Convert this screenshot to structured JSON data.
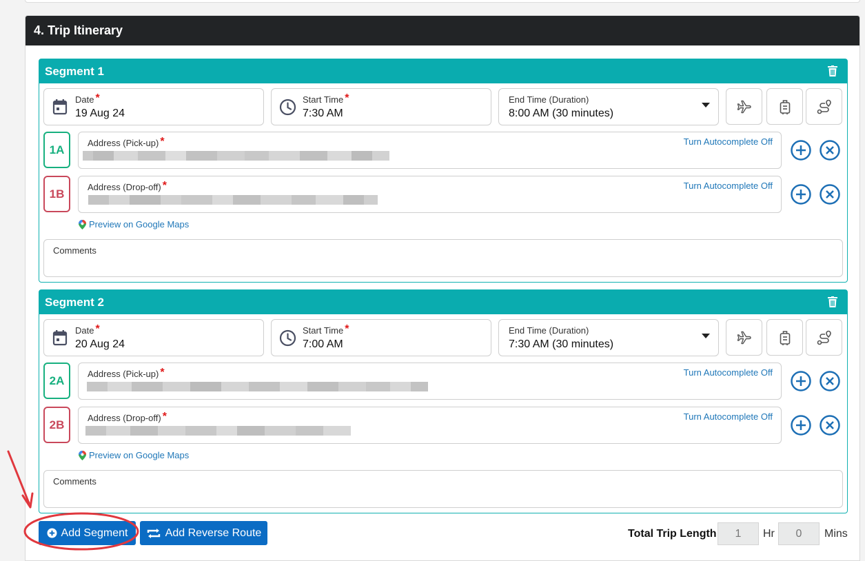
{
  "section": {
    "title": "4. Trip Itinerary"
  },
  "labels": {
    "date": "Date",
    "start_time": "Start Time",
    "end_time": "End Time (Duration)",
    "pickup": "Address (Pick-up)",
    "dropoff": "Address (Drop-off)",
    "required_mark": "*",
    "autocomplete": "Turn Autocomplete Off",
    "preview_maps": "Preview on Google Maps",
    "comments": "Comments"
  },
  "segments": [
    {
      "title": "Segment 1",
      "date": "19 Aug 24",
      "start_time": "7:30 AM",
      "end_time": "8:00 AM (30 minutes)",
      "pickup_badge": "1A",
      "dropoff_badge": "1B"
    },
    {
      "title": "Segment 2",
      "date": "20 Aug 24",
      "start_time": "7:00 AM",
      "end_time": "7:30 AM (30 minutes)",
      "pickup_badge": "2A",
      "dropoff_badge": "2B"
    }
  ],
  "actions": {
    "add_segment": "Add Segment",
    "add_reverse_route": "Add Reverse Route"
  },
  "total": {
    "label": "Total Trip Length",
    "hours": "1",
    "hours_unit": "Hr",
    "minutes": "0",
    "minutes_unit": "Mins"
  },
  "colors": {
    "accent": "#0aacaf",
    "primary": "#0b6cc4",
    "pickup": "#17b07f",
    "dropoff": "#c9485b",
    "annotation": "#e0383e"
  },
  "icons": {
    "date": "calendar-icon",
    "time": "clock-icon",
    "flight": "airplane-icon",
    "luggage": "luggage-icon",
    "route": "route-icon",
    "delete": "trash-icon",
    "add": "plus-circle-icon",
    "remove": "x-circle-icon",
    "maps": "map-pin-icon"
  }
}
